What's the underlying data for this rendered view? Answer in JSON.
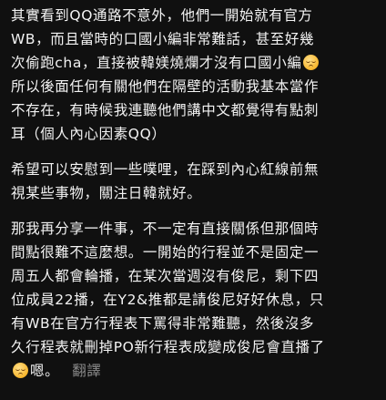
{
  "post": {
    "paragraphs": [
      {
        "lines": [
          "其實看到QQ通路不意外，他們一開始就有官方",
          "WB，而且當時的口國小編非常難話，甚至好幾",
          "次偷跑cha，直接被韓媄燒爛才沒有口國小編",
          "所以後面任何有關他們在隔壁的活動我基本當作",
          "不存在，有時候我連聽他們講中文都覺得有點刺",
          "耳（個人內心因素QQ）"
        ]
      },
      {
        "lines": [
          "希望可以安慰到一些噗哩，在踩到內心紅線前無",
          "視某些事物，關注日韓就好。"
        ]
      },
      {
        "lines": [
          "那我再分享一件事，不一定有直接關係但那個時",
          "間點很難不這麼想。一開始的行程並不是固定一",
          "周五人都會輪播，在某次當週沒有俊尼，剩下四",
          "位成員22播，在Y2&推都是請俊尼好好休息，只",
          "有WB在官方行程表下罵得非常難聽，然後沒多",
          "久行程表就刪掉PO新行程表成變成俊尼會直播了"
        ],
        "last_line_text": "嗯。"
      }
    ],
    "translate_label": "翻譯",
    "emoji_icon": "pensive-face-emoji"
  }
}
